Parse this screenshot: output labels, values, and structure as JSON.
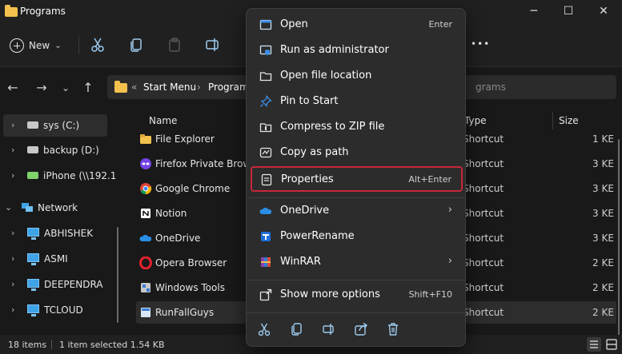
{
  "window": {
    "title": "Programs",
    "minimize_glyph": "─",
    "maximize_glyph": "☐",
    "close_glyph": "✕"
  },
  "toolbar": {
    "new_label": "New",
    "new_chevron": "⌄",
    "more_glyph": "•••"
  },
  "nav": {
    "back_glyph": "←",
    "forward_glyph": "→",
    "recent_glyph": "⌄",
    "up_glyph": "↑",
    "breadcrumb_sep": "«",
    "breadcrumb": [
      "Start Menu",
      "›",
      "Programs"
    ],
    "search_placeholder": "grams"
  },
  "sidebar": {
    "items": [
      {
        "label": "sys (C:)",
        "icon": "drive-icon",
        "selected": true
      },
      {
        "label": "backup (D:)",
        "icon": "drive-icon"
      },
      {
        "label": "iPhone (\\\\192.1",
        "icon": "network-drive-icon"
      },
      {
        "label": "Network",
        "icon": "network-icon",
        "expanded": true
      },
      {
        "label": "ABHISHEK",
        "icon": "computer-icon"
      },
      {
        "label": "ASMI",
        "icon": "computer-icon"
      },
      {
        "label": "DEEPENDRA",
        "icon": "computer-icon"
      },
      {
        "label": "TCLOUD",
        "icon": "computer-icon"
      }
    ],
    "chevron_right": "›",
    "chevron_down": "⌄"
  },
  "filelist": {
    "columns": {
      "name": "Name",
      "type": "Type",
      "size": "Size"
    },
    "rows": [
      {
        "name": "File Explorer",
        "type": "Shortcut",
        "size": "1 KE",
        "icon": "folder-shortcut-icon"
      },
      {
        "name": "Firefox Private Browsi",
        "type": "Shortcut",
        "size": "3 KE",
        "icon": "firefox-private-icon"
      },
      {
        "name": "Google Chrome",
        "type": "Shortcut",
        "size": "3 KE",
        "icon": "chrome-icon"
      },
      {
        "name": "Notion",
        "type": "Shortcut",
        "size": "3 KE",
        "icon": "notion-icon"
      },
      {
        "name": "OneDrive",
        "type": "Shortcut",
        "size": "3 KE",
        "icon": "onedrive-icon"
      },
      {
        "name": "Opera Browser",
        "type": "Shortcut",
        "size": "2 KE",
        "icon": "opera-icon"
      },
      {
        "name": "Windows Tools",
        "type": "Shortcut",
        "size": "2 KE",
        "icon": "windows-tools-icon"
      },
      {
        "name": "RunFallGuys",
        "type": "Shortcut",
        "size": "2 KE",
        "icon": "app-shortcut-icon",
        "selected": true
      }
    ]
  },
  "status": {
    "items_count": "18 items",
    "selection": "1 item selected  1.54 KB"
  },
  "context_menu": {
    "items": [
      {
        "label": "Open",
        "shortcut": "Enter",
        "icon": "open-icon"
      },
      {
        "label": "Run as administrator",
        "shortcut": "",
        "icon": "shield-icon"
      },
      {
        "label": "Open file location",
        "shortcut": "",
        "icon": "folder-icon"
      },
      {
        "label": "Pin to Start",
        "shortcut": "",
        "icon": "pin-icon"
      },
      {
        "label": "Compress to ZIP file",
        "shortcut": "",
        "icon": "zip-icon"
      },
      {
        "label": "Copy as path",
        "shortcut": "",
        "icon": "copy-path-icon"
      },
      {
        "label": "Properties",
        "shortcut": "Alt+Enter",
        "icon": "properties-icon",
        "highlighted": true
      }
    ],
    "submenu_items": [
      {
        "label": "OneDrive",
        "arrow": "›",
        "icon": "onedrive-icon"
      },
      {
        "label": "PowerRename",
        "icon": "powerrename-icon"
      },
      {
        "label": "WinRAR",
        "arrow": "›",
        "icon": "winrar-icon"
      }
    ],
    "more": {
      "label": "Show more options",
      "shortcut": "Shift+F10",
      "icon": "more-options-icon"
    },
    "highlight_color": "#c8273a"
  }
}
